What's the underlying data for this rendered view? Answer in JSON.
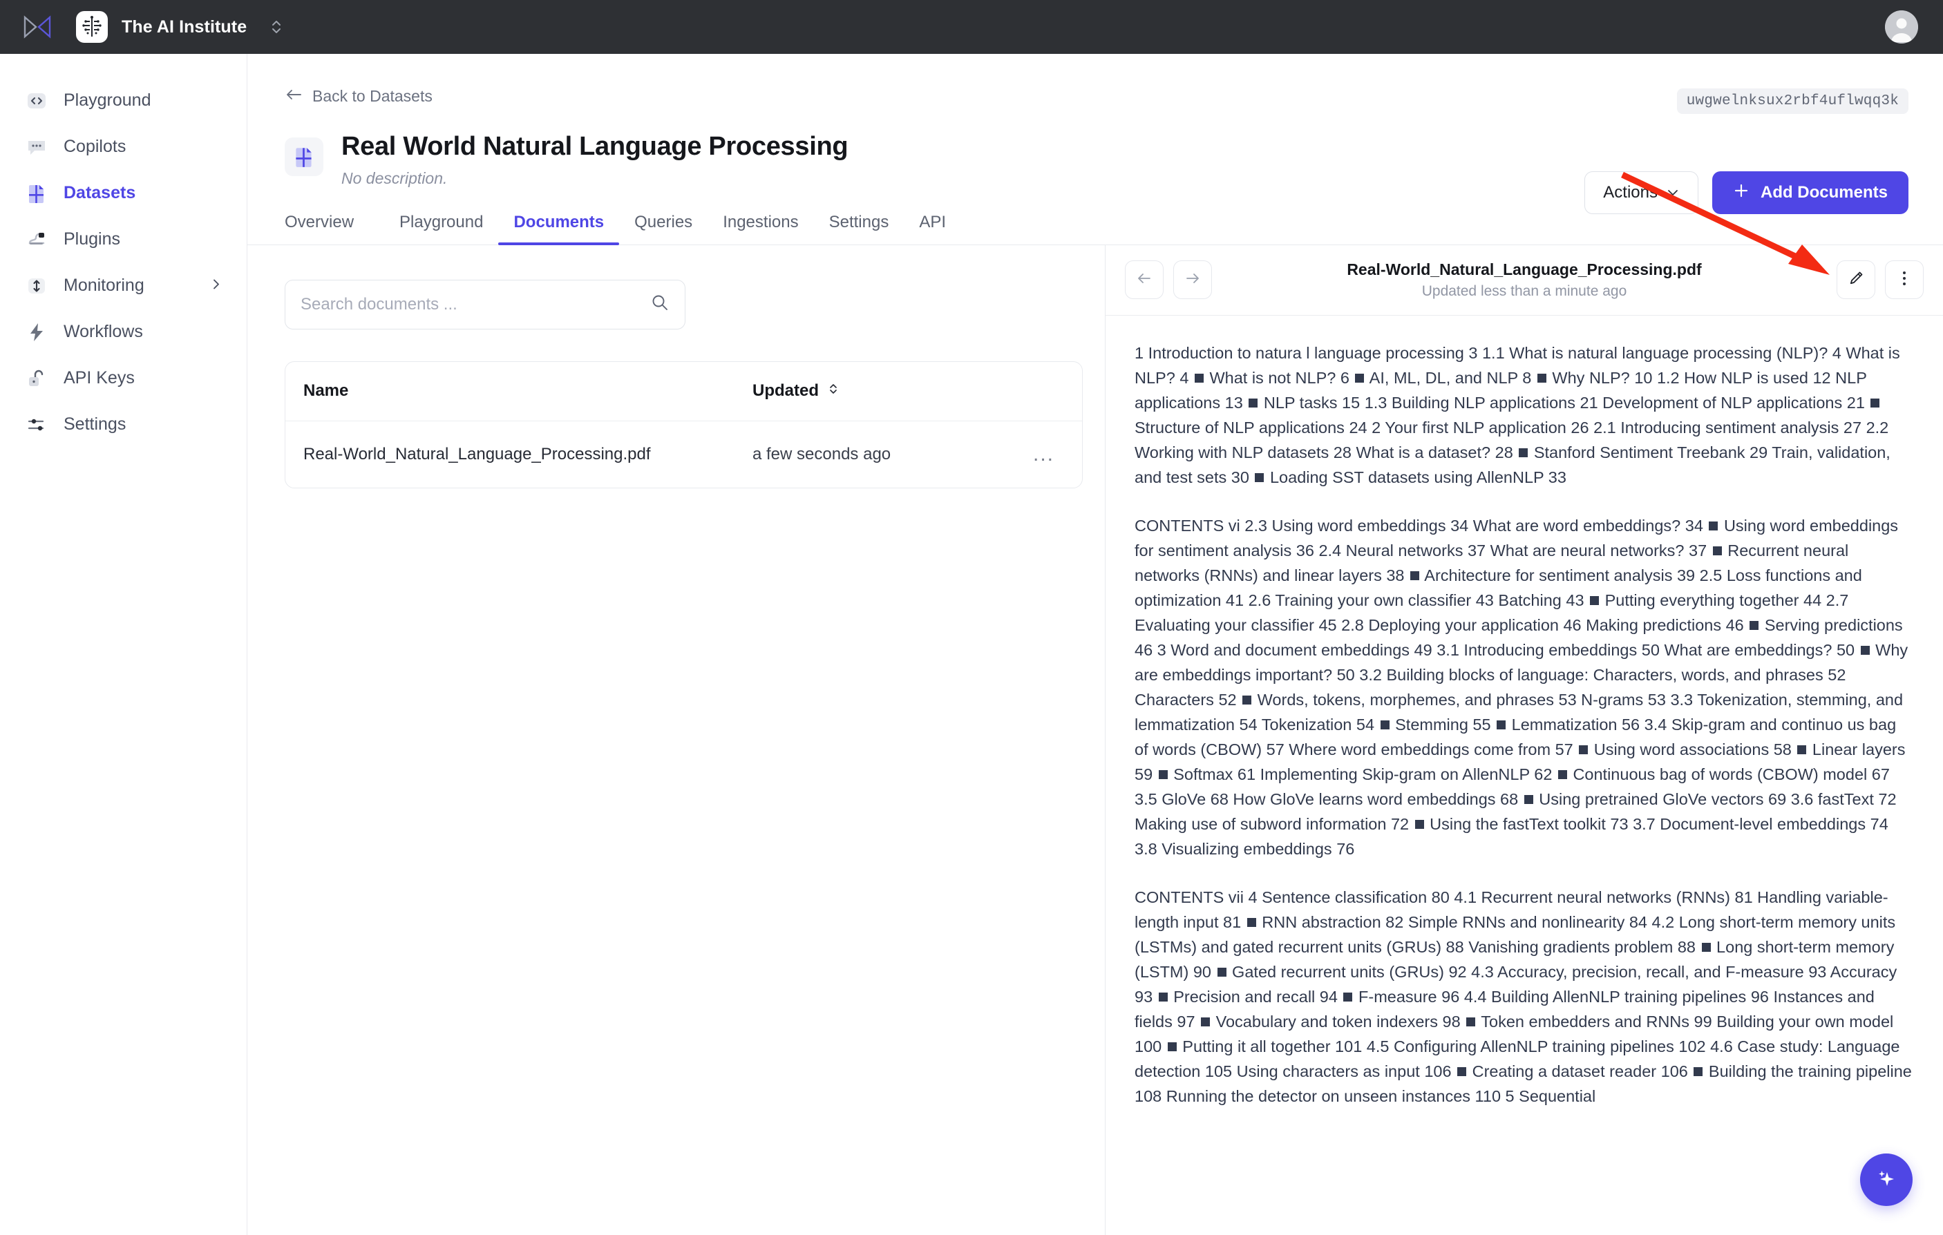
{
  "topbar": {
    "brand_icon": "bowtie-logo-icon",
    "org_logo_icon": "brain-circuit-icon",
    "org_name": "The AI Institute",
    "org_switch_icon": "chevron-up-down-icon",
    "avatar_icon": "user-avatar-icon"
  },
  "sidebar": {
    "items": [
      {
        "label": "Playground",
        "icon": "code-brackets-icon",
        "active": false,
        "expandable": false
      },
      {
        "label": "Copilots",
        "icon": "chat-bubble-icon",
        "active": false,
        "expandable": false
      },
      {
        "label": "Datasets",
        "icon": "dataset-icon",
        "active": true,
        "expandable": false
      },
      {
        "label": "Plugins",
        "icon": "plug-icon",
        "active": false,
        "expandable": false
      },
      {
        "label": "Monitoring",
        "icon": "updown-arrow-icon",
        "active": false,
        "expandable": true
      },
      {
        "label": "Workflows",
        "icon": "lightning-bolt-icon",
        "active": false,
        "expandable": false
      },
      {
        "label": "API Keys",
        "icon": "lock-icon",
        "active": false,
        "expandable": false
      },
      {
        "label": "Settings",
        "icon": "sliders-icon",
        "active": false,
        "expandable": false
      }
    ]
  },
  "header": {
    "back_label": "Back to Datasets",
    "back_icon": "arrow-left-icon",
    "dataset_id": "uwgwelnksux2rbf4uflwqq3k",
    "dataset_icon": "dataset-icon",
    "title": "Real World Natural Language Processing",
    "subtitle": "No description.",
    "actions_label": "Actions",
    "actions_chevron_icon": "chevron-down-icon",
    "add_documents_label": "Add Documents",
    "add_icon": "plus-icon"
  },
  "tabs": [
    {
      "label": "Overview",
      "active": false
    },
    {
      "label": "Playground",
      "active": false
    },
    {
      "label": "Documents",
      "active": true
    },
    {
      "label": "Queries",
      "active": false
    },
    {
      "label": "Ingestions",
      "active": false
    },
    {
      "label": "Settings",
      "active": false
    },
    {
      "label": "API",
      "active": false
    }
  ],
  "documents_panel": {
    "search_placeholder": "Search documents ...",
    "search_value": "",
    "search_icon": "search-icon",
    "columns": [
      {
        "label": "Name",
        "sortable": false
      },
      {
        "label": "Updated",
        "sortable": true,
        "sort_icon": "sort-updown-icon"
      }
    ],
    "rows": [
      {
        "name": "Real-World_Natural_Language_Processing.pdf",
        "updated": "a few seconds ago",
        "menu_icon": "ellipsis-icon",
        "menu_label": "..."
      }
    ]
  },
  "preview": {
    "prev_icon": "arrow-left-icon",
    "next_icon": "arrow-right-icon",
    "title": "Real-World_Natural_Language_Processing.pdf",
    "subtitle": "Updated less than a minute ago",
    "edit_icon": "pencil-icon",
    "more_icon": "vertical-ellipsis-icon",
    "paragraphs": [
      "1 Introduction to natura l language processing 3 1.1 What is natural language processing (NLP)? 4 What is NLP? 4 ■ What is not NLP? 6 ■ AI, ML, DL, and NLP 8 ■ Why NLP? 10 1.2 How NLP is used 12 NLP applications 13 ■ NLP tasks 15 1.3 Building NLP applications 21 Development of NLP applications 21 ■ Structure of NLP applications 24 2 Your first NLP application 26 2.1 Introducing sentiment analysis 27 2.2 Working with NLP datasets 28 What is a dataset? 28 ■ Stanford Sentiment Treebank 29 Train, validation, and test sets 30 ■ Loading SST datasets using AllenNLP 33",
      "CONTENTS vi 2.3 Using word embeddings 34 What are word embeddings? 34 ■ Using word embeddings for sentiment analysis 36 2.4 Neural networks 37 What are neural networks? 37 ■ Recurrent neural networks (RNNs) and linear layers 38 ■ Architecture for sentiment analysis 39 2.5 Loss functions and optimization 41 2.6 Training your own classifier 43 Batching 43 ■ Putting everything together 44 2.7 Evaluating your classifier 45 2.8 Deploying your application 46 Making predictions 46 ■ Serving predictions 46 3 Word and document embeddings 49 3.1 Introducing embeddings 50 What are embeddings? 50 ■ Why are embeddings important? 50 3.2 Building blocks of language: Characters, words, and phrases 52 Characters 52 ■ Words, tokens, morphemes, and phrases 53 N-grams 53 3.3 Tokenization, stemming, and lemmatization 54 Tokenization 54 ■ Stemming 55 ■ Lemmatization 56 3.4 Skip-gram and continuo us bag of words (CBOW) 57 Where word embeddings come from 57 ■ Using word associations 58 ■ Linear layers 59 ■ Softmax 61 Implementing Skip-gram on AllenNLP 62 ■ Continuous bag of words (CBOW) model 67 3.5 GloVe 68 How GloVe learns word embeddings 68 ■ Using pretrained GloVe vectors 69 3.6 fastText 72 Making use of subword information 72 ■ Using the fastText toolkit 73 3.7 Document-level embeddings 74 3.8 Visualizing embeddings 76",
      "CONTENTS vii 4 Sentence classification 80 4.1 Recurrent neural networks (RNNs) 81 Handling variable-length input 81 ■ RNN abstraction 82 Simple RNNs and nonlinearity 84 4.2 Long short-term memory units (LSTMs) and gated recurrent units (GRUs) 88 Vanishing gradients problem 88 ■ Long short-term memory (LSTM) 90 ■ Gated recurrent units (GRUs) 92 4.3 Accuracy, precision, recall, and F-measure 93 Accuracy 93 ■ Precision and recall 94 ■ F-measure 96 4.4 Building AllenNLP training pipelines 96 Instances and fields 97 ■ Vocabulary and token indexers 98 ■ Token embedders and RNNs 99 Building your own model 100 ■ Putting it all together 101 4.5 Configuring AllenNLP training pipelines 102 4.6 Case study: Language detection 105 Using characters as input 106 ■ Creating a dataset reader 106 ■ Building the training pipeline 108 Running the detector on unseen instances 110 5 Sequential"
    ]
  },
  "fab": {
    "icon": "sparkles-icon",
    "label": "AI assistant"
  },
  "annotation": {
    "type": "arrow",
    "color": "#f32b13"
  },
  "colors": {
    "accent": "#4f46e5",
    "topbar": "#2e3034",
    "text": "#15171c",
    "muted": "#8b90a0",
    "border": "#e8eaee",
    "annotation_red": "#f32b13"
  }
}
